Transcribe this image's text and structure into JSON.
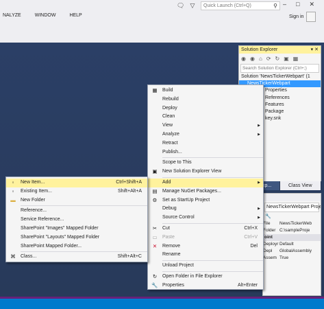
{
  "menubar": {
    "items": [
      "NALYZE",
      "WINDOW",
      "HELP"
    ]
  },
  "titlebar": {
    "quick_launch_placeholder": "Quick Launch (Ctrl+Q)",
    "sign_in": "Sign in",
    "icons": [
      "notification-icon",
      "filter-icon",
      "search-icon",
      "minimize-icon",
      "maximize-icon",
      "close-icon"
    ]
  },
  "solution_explorer": {
    "title": "Solution Explorer",
    "search_placeholder": "Search Solution Explorer (Ctrl+;)",
    "tree": [
      {
        "label": "Solution 'NewsTickerWebpart' (1"
      },
      {
        "label": "NewsTickerWebpart",
        "selected": true
      },
      {
        "label": "Properties"
      },
      {
        "label": "References"
      },
      {
        "label": "Features"
      },
      {
        "label": "Package"
      },
      {
        "label": "key.snk"
      }
    ],
    "tabs": [
      "Team Exp...",
      "Class View"
    ]
  },
  "properties": {
    "combo": "NewsTickerWebpart  Project Prop",
    "rows": [
      {
        "k": "File",
        "v": "NewsTickerWeb"
      },
      {
        "k": "Folder",
        "v": "C:\\sampleProje"
      },
      {
        "k": "oint",
        "v": "",
        "category": true
      },
      {
        "k": "Deployr",
        "v": "Default"
      },
      {
        "k": "Depl",
        "v": "GlobalAssembly"
      },
      {
        "k": "Assem",
        "v": "True"
      }
    ]
  },
  "context_menu": {
    "items": [
      {
        "label": "Build",
        "icon": "build-icon",
        "glyph": "▦"
      },
      {
        "label": "Rebuild"
      },
      {
        "label": "Deploy"
      },
      {
        "label": "Clean"
      },
      {
        "label": "View",
        "submenu": true
      },
      {
        "label": "Analyze",
        "submenu": true
      },
      {
        "label": "Retract"
      },
      {
        "label": "Publish..."
      },
      {
        "separator": true
      },
      {
        "label": "Scope to This"
      },
      {
        "label": "New Solution Explorer View",
        "icon": "new-view-icon",
        "glyph": "▣"
      },
      {
        "separator": true
      },
      {
        "label": "Add",
        "submenu": true,
        "highlighted": true
      },
      {
        "label": "Manage NuGet Packages...",
        "icon": "nuget-icon",
        "glyph": "▤"
      },
      {
        "label": "Set as StartUp Project",
        "icon": "gear-icon",
        "glyph": "⚙"
      },
      {
        "label": "Debug",
        "submenu": true
      },
      {
        "label": "Source Control",
        "submenu": true
      },
      {
        "separator": true
      },
      {
        "label": "Cut",
        "shortcut": "Ctrl+X",
        "icon": "cut-icon",
        "glyph": "✂"
      },
      {
        "label": "Paste",
        "shortcut": "Ctrl+V",
        "icon": "paste-icon",
        "glyph": "▭",
        "disabled": true
      },
      {
        "label": "Remove",
        "shortcut": "Del",
        "icon": "remove-icon",
        "glyph": "✕",
        "color": "#c8102e"
      },
      {
        "label": "Rename"
      },
      {
        "separator": true
      },
      {
        "label": "Unload Project"
      },
      {
        "separator": true
      },
      {
        "label": "Open Folder in File Explorer",
        "icon": "folder-refresh-icon",
        "glyph": "↻"
      },
      {
        "label": "Properties",
        "shortcut": "Alt+Enter",
        "icon": "wrench-icon",
        "glyph": "🔧"
      }
    ]
  },
  "add_submenu": {
    "items": [
      {
        "label": "New Item...",
        "shortcut": "Ctrl+Shift+A",
        "icon": "new-item-icon",
        "glyph": "▫",
        "highlighted": true
      },
      {
        "label": "Existing Item...",
        "shortcut": "Shift+Alt+A",
        "icon": "existing-item-icon",
        "glyph": "▫"
      },
      {
        "label": "New Folder",
        "icon": "folder-icon",
        "glyph": "▬",
        "color": "#dcb042"
      },
      {
        "separator": true
      },
      {
        "label": "Reference..."
      },
      {
        "label": "Service Reference..."
      },
      {
        "label": "SharePoint \"Images\" Mapped Folder"
      },
      {
        "label": "SharePoint \"Layouts\" Mapped Folder"
      },
      {
        "label": "SharePoint Mapped Folder..."
      },
      {
        "separator": true
      },
      {
        "label": "Class...",
        "shortcut": "Shift+Alt+C",
        "icon": "class-icon",
        "glyph": "⌘"
      }
    ]
  }
}
